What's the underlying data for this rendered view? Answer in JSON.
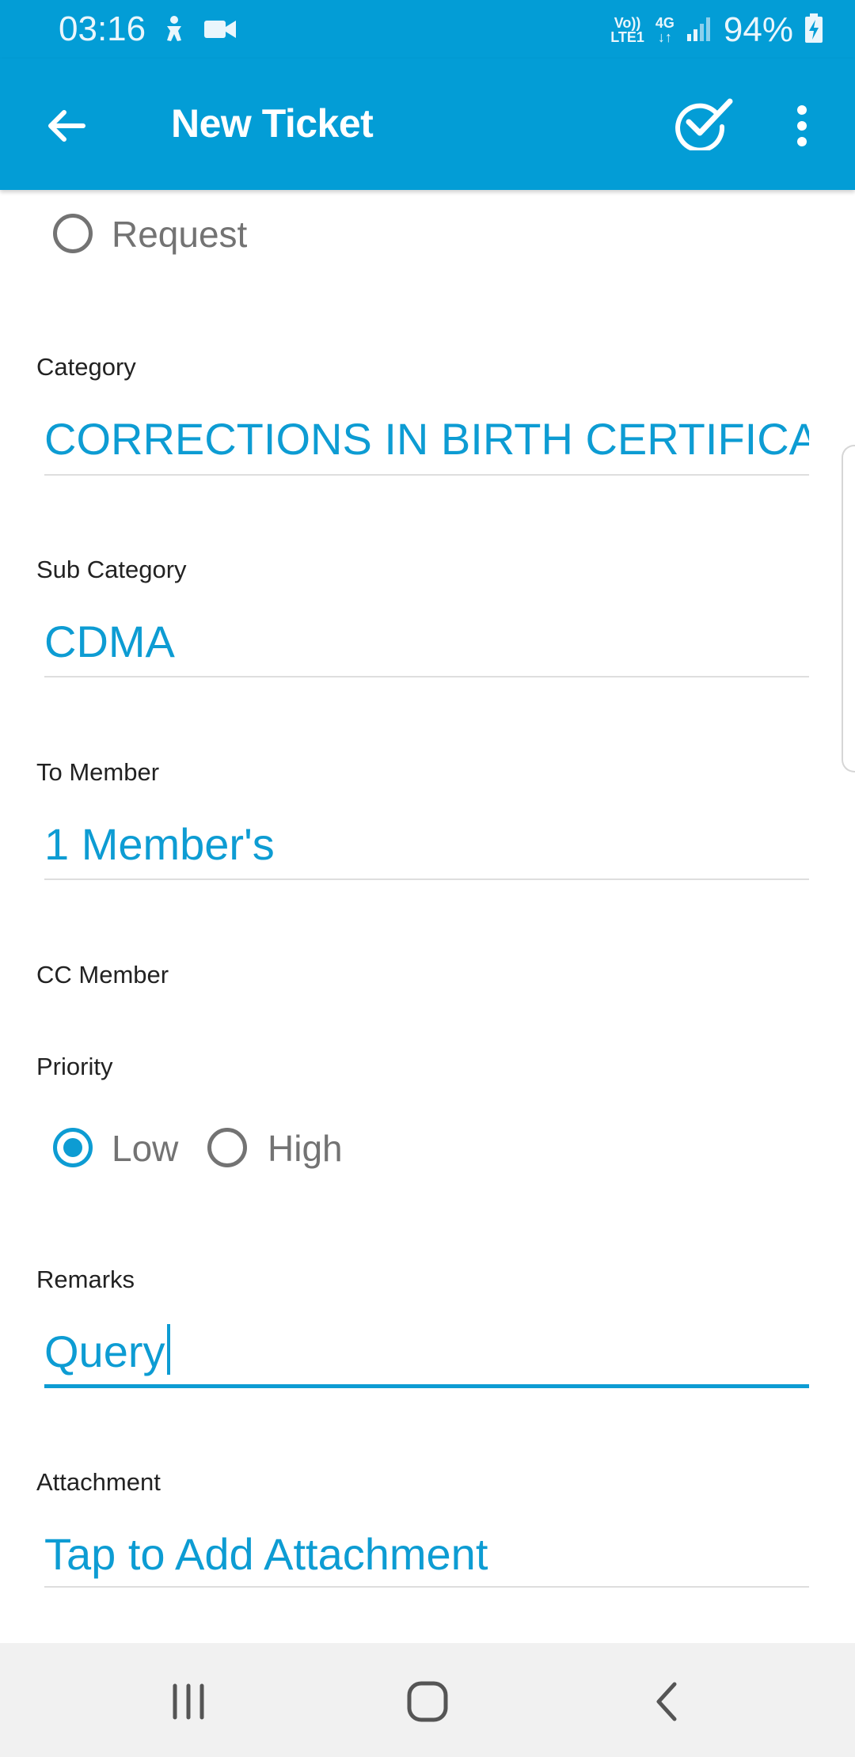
{
  "status_bar": {
    "time": "03:16",
    "network_top": "Vo))",
    "network_bottom": "LTE1",
    "data_type": "4G",
    "battery_percent": "94%",
    "icons": [
      "accessibility-icon",
      "video-camera-icon",
      "signal-icon",
      "battery-charging-icon"
    ]
  },
  "app_bar": {
    "title": "New Ticket",
    "icons": [
      "arrow-back-icon",
      "check-circle-icon",
      "more-vert-icon"
    ]
  },
  "form": {
    "ticket_type": {
      "option_label": "Request",
      "selected": false
    },
    "category": {
      "label": "Category",
      "value": "CORRECTIONS IN BIRTH CERTIFICATE"
    },
    "sub_category": {
      "label": "Sub Category",
      "value": "CDMA"
    },
    "to_member": {
      "label": "To Member",
      "value": "1 Member's"
    },
    "cc_member": {
      "label": "CC Member"
    },
    "priority": {
      "label": "Priority",
      "options": [
        {
          "label": "Low",
          "selected": true
        },
        {
          "label": "High",
          "selected": false
        }
      ]
    },
    "remarks": {
      "label": "Remarks",
      "value": "Query"
    },
    "attachment": {
      "label": "Attachment",
      "value": "Tap to Add Attachment"
    }
  },
  "nav_bar": {
    "icons": [
      "recent-apps-icon",
      "home-icon",
      "back-icon"
    ]
  },
  "colors": {
    "app_bar": "#039dd6",
    "accent": "#0d9cd3",
    "radio_unselected": "#737373",
    "nav_bar": "#f1f1f1"
  }
}
